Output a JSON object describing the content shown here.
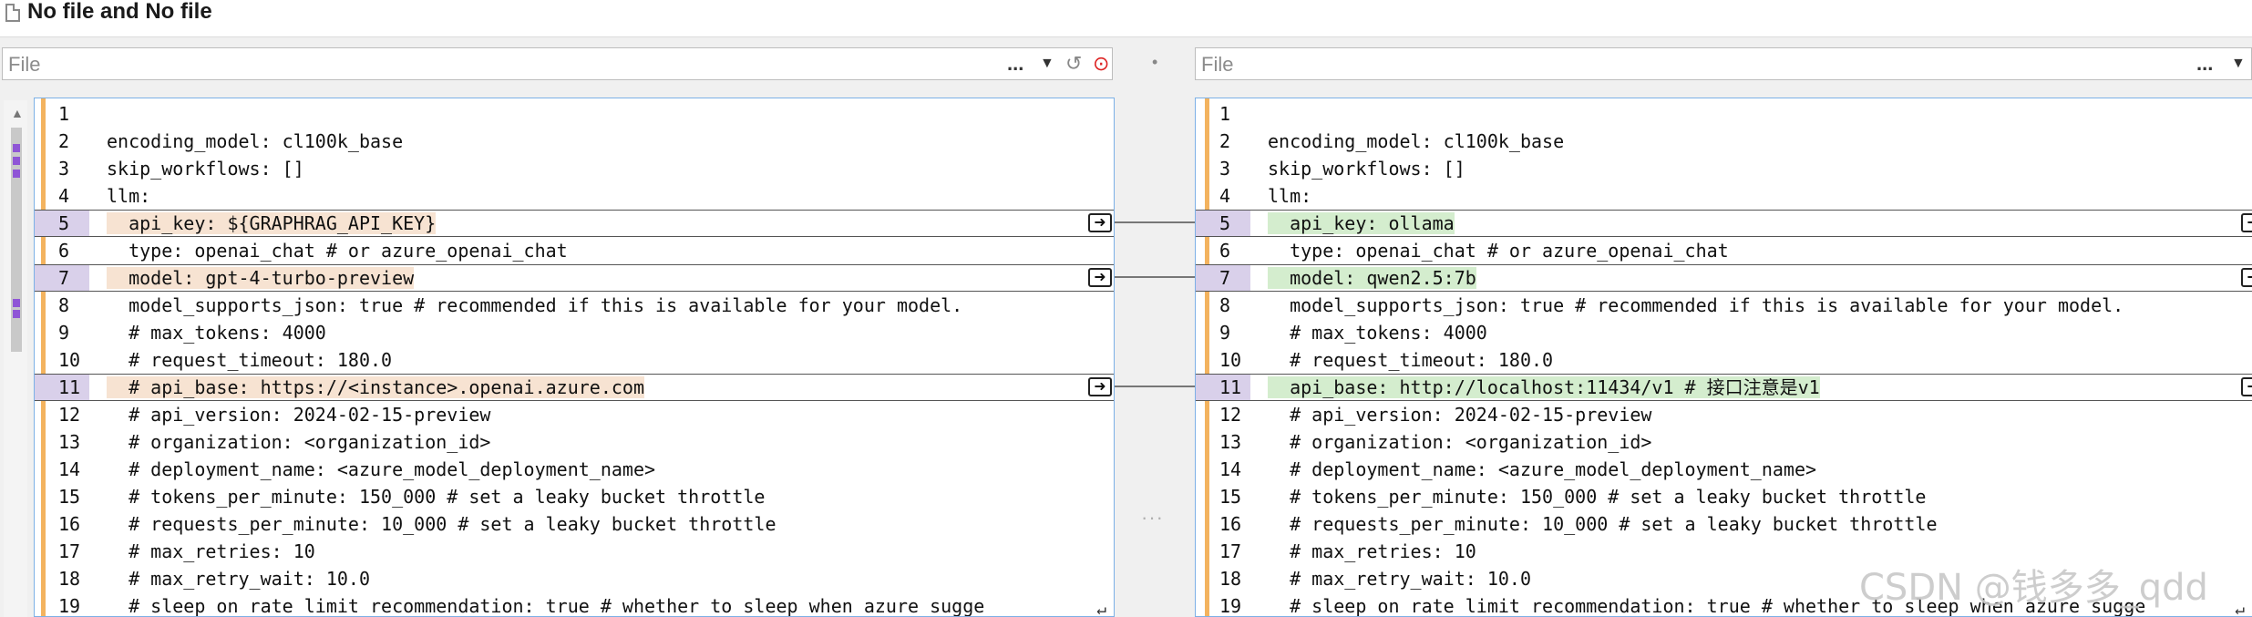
{
  "window": {
    "title": "No file and No file"
  },
  "left_file": {
    "placeholder": "File",
    "more": "...",
    "dropdown": "▼",
    "history": "↺",
    "stop": "⊙"
  },
  "right_file": {
    "placeholder": "File",
    "more": "...",
    "dropdown": "▼"
  },
  "center": {
    "dot": "•",
    "more": "···"
  },
  "left_lines": [
    {
      "n": "1",
      "code": ""
    },
    {
      "n": "2",
      "code": "encoding_model: cl100k_base"
    },
    {
      "n": "3",
      "code": "skip_workflows: []"
    },
    {
      "n": "4",
      "code": "llm:"
    },
    {
      "n": "5",
      "code": "  api_key: ${GRAPHRAG_API_KEY}"
    },
    {
      "n": "6",
      "code": "  type: openai_chat # or azure_openai_chat"
    },
    {
      "n": "7",
      "code": "  model: gpt-4-turbo-preview"
    },
    {
      "n": "8",
      "code": "  model_supports_json: true # recommended if this is available for your model."
    },
    {
      "n": "9",
      "code": "  # max_tokens: 4000"
    },
    {
      "n": "10",
      "code": "  # request_timeout: 180.0"
    },
    {
      "n": "11",
      "code": "  # api_base: https://<instance>.openai.azure.com"
    },
    {
      "n": "12",
      "code": "  # api_version: 2024-02-15-preview"
    },
    {
      "n": "13",
      "code": "  # organization: <organization_id>"
    },
    {
      "n": "14",
      "code": "  # deployment_name: <azure_model_deployment_name>"
    },
    {
      "n": "15",
      "code": "  # tokens_per_minute: 150_000 # set a leaky bucket throttle"
    },
    {
      "n": "16",
      "code": "  # requests_per_minute: 10_000 # set a leaky bucket throttle"
    },
    {
      "n": "17",
      "code": "  # max_retries: 10"
    },
    {
      "n": "18",
      "code": "  # max_retry_wait: 10.0"
    },
    {
      "n": "19",
      "code": "  # sleep_on_rate_limit_recommendation: true # whether to sleep when azure sugge"
    }
  ],
  "right_lines": [
    {
      "n": "1",
      "code": ""
    },
    {
      "n": "2",
      "code": "encoding_model: cl100k_base"
    },
    {
      "n": "3",
      "code": "skip_workflows: []"
    },
    {
      "n": "4",
      "code": "llm:"
    },
    {
      "n": "5",
      "code": "  api_key: ollama"
    },
    {
      "n": "6",
      "code": "  type: openai_chat # or azure_openai_chat"
    },
    {
      "n": "7",
      "code": "  model: qwen2.5:7b"
    },
    {
      "n": "8",
      "code": "  model_supports_json: true # recommended if this is available for your model."
    },
    {
      "n": "9",
      "code": "  # max_tokens: 4000"
    },
    {
      "n": "10",
      "code": "  # request_timeout: 180.0"
    },
    {
      "n": "11",
      "code": "  api_base: http://localhost:11434/v1 # 接口注意是v1"
    },
    {
      "n": "12",
      "code": "  # api_version: 2024-02-15-preview"
    },
    {
      "n": "13",
      "code": "  # organization: <organization_id>"
    },
    {
      "n": "14",
      "code": "  # deployment_name: <azure_model_deployment_name>"
    },
    {
      "n": "15",
      "code": "  # tokens_per_minute: 150_000 # set a leaky bucket throttle"
    },
    {
      "n": "16",
      "code": "  # requests_per_minute: 10_000 # set a leaky bucket throttle"
    },
    {
      "n": "17",
      "code": "  # max_retries: 10"
    },
    {
      "n": "18",
      "code": "  # max_retry_wait: 10.0"
    },
    {
      "n": "19",
      "code": "  # sleep_on_rate_limit_recommendation: true # whether to sleep when azure sugge"
    }
  ],
  "changed_lines": [
    5,
    7,
    11
  ],
  "arrow_glyph": "➜",
  "wrap_glyph": "↵",
  "watermark": "CSDN @钱多多_qdd",
  "colors": {
    "changed_left": "#f7e3d2",
    "changed_right": "#d4edce",
    "line_number_changed": "#d9d0ea",
    "gutter": "#f3b35f",
    "overview_mark": "#8f55d6"
  }
}
